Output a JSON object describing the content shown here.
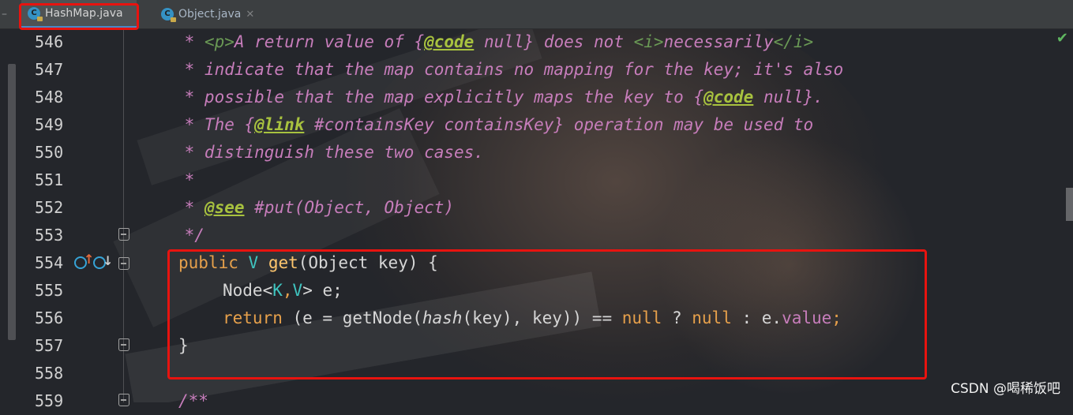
{
  "tabs": [
    {
      "label": "HashMap.java",
      "active": true,
      "icon": "class-icon"
    },
    {
      "label": "Object.java",
      "active": false,
      "icon": "class-icon"
    }
  ],
  "line_numbers": [
    "546",
    "547",
    "548",
    "549",
    "550",
    "551",
    "552",
    "553",
    "554",
    "555",
    "556",
    "557",
    "558",
    "559"
  ],
  "code": {
    "l546": {
      "star": " * ",
      "p_tag": "<p>",
      "t1": "A return value of {",
      "code_tag": "@code",
      "t2": " null} does not ",
      "i_open": "<i>",
      "t3": "necessarily",
      "i_close": "</i>"
    },
    "l547": {
      "text": " * indicate that the map contains no mapping for the key; it's also"
    },
    "l548": {
      "t1": " * possible that the map explicitly maps the key to {",
      "code_tag": "@code",
      "t2": " null}."
    },
    "l549": {
      "t1": " * The {",
      "link_tag": "@link",
      "t2": " #containsKey containsKey} operation may be used to"
    },
    "l550": {
      "text": " * distinguish these two cases."
    },
    "l551": {
      "text": " *"
    },
    "l552": {
      "star": " * ",
      "see_tag": "@see",
      "t2": " #put(Object, Object)"
    },
    "l553": {
      "text": " */"
    },
    "l554": {
      "kw_public": "public",
      "type_v": "V",
      "method": "get",
      "params": "(Object key) {"
    },
    "l555": {
      "node": "Node<",
      "k": "K",
      "comma": ",",
      "v": "V",
      "rest": "> e;"
    },
    "l556": {
      "kw_return": "return",
      "p1": " (e = getNode(",
      "hash": "hash",
      "p2": "(key), key)) == ",
      "null1": "null",
      "q": " ? ",
      "null2": "null",
      "colon": " : e.",
      "value": "value",
      "semi": ";"
    },
    "l557": {
      "text": "}"
    },
    "l559": {
      "text": "/**"
    }
  },
  "watermark": "CSDN @喝稀饭吧",
  "status_icon": "check-icon",
  "colors": {
    "highlight": "#e8130f",
    "keyword": "#e6a04b",
    "doc": "#c77dbb",
    "type_param": "#3fc5c0",
    "method": "#ffc66d"
  }
}
